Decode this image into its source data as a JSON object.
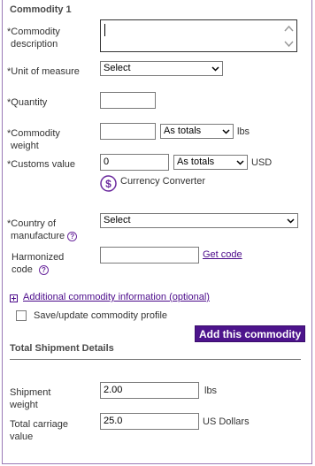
{
  "commodity": {
    "title": "Commodity 1",
    "description_label_line1": "*Commodity",
    "description_label_line2": "description",
    "description_value": "",
    "unit_label": "*Unit of measure",
    "unit_value": "Select",
    "quantity_label": "*Quantity",
    "quantity_value": "",
    "weight_label_line1": "*Commodity",
    "weight_label_line2": "weight",
    "weight_value": "",
    "weight_type": "As totals",
    "weight_unit": "lbs",
    "customs_label": "*Customs value",
    "customs_value": "0",
    "customs_type": "As totals",
    "customs_currency": "USD",
    "currency_converter": "Currency Converter",
    "currency_icon": "dollar-circle-icon",
    "country_label_line1": "*Country of",
    "country_label_line2": "manufacture",
    "country_value": "Select",
    "harmonized_label_line1": "Harmonized",
    "harmonized_label_line2": "code",
    "harmonized_value": "",
    "get_code": "Get code",
    "additional_info": "Additional commodity information (optional)",
    "save_profile": "Save/update commodity profile",
    "add_button": "Add this commodity"
  },
  "shipment": {
    "title": "Total Shipment Details",
    "weight_label_line1": "Shipment",
    "weight_label_line2": "weight",
    "weight_value": "2.00",
    "weight_unit": "lbs",
    "carriage_label_line1": "Total carriage",
    "carriage_label_line2": "value",
    "carriage_value": "25.0",
    "carriage_unit": "US Dollars"
  },
  "colors": {
    "accent": "#4d148c",
    "link": "#4b0a8a",
    "border": "#9a7ab6"
  }
}
